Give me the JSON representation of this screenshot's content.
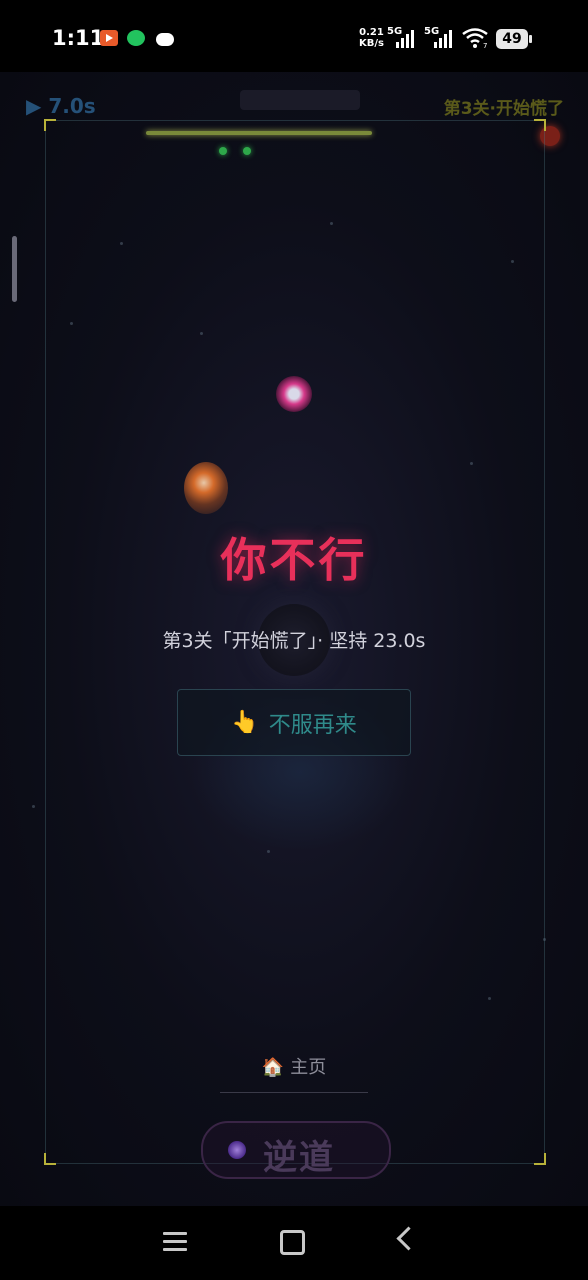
{
  "status_bar": {
    "time": "1:11",
    "net_speed_value": "0.21",
    "net_speed_unit": "KB/s",
    "signal1_label": "5G",
    "signal2_label": "5G",
    "wifi_label": "7",
    "battery": "49"
  },
  "hud": {
    "timer": "▶ 7.0s",
    "level_label": "第3关·开始慌了"
  },
  "result": {
    "title": "你不行",
    "subtitle": "第3关「开始慌了」· 坚持 23.0s",
    "retry_icon": "👆",
    "retry_label": "不服再来"
  },
  "footer": {
    "home_icon": "🏠",
    "home_label": "主页",
    "logo_text": "逆道"
  },
  "colors": {
    "title": "#e8305a",
    "retry_text": "#2f8a8a",
    "hud_level": "#5a5a1a",
    "background": "#0b0c14"
  }
}
